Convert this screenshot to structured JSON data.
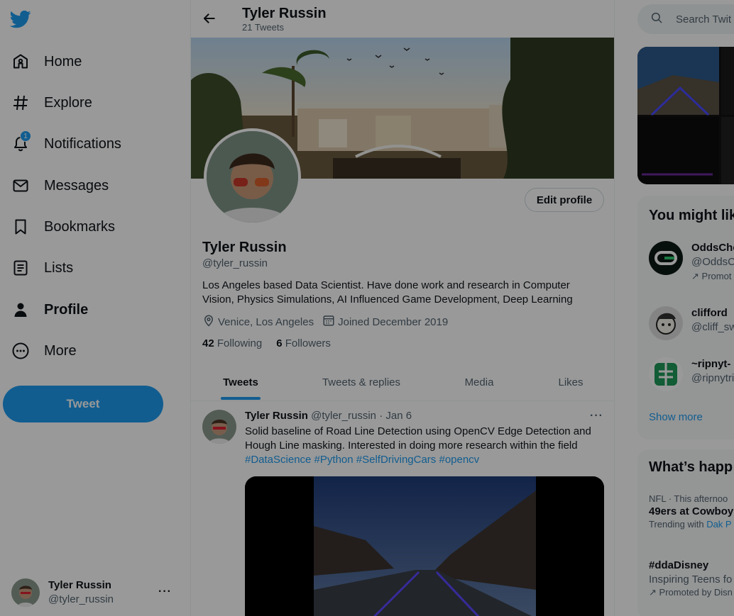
{
  "colors": {
    "accent": "#1d9bf0",
    "text": "#0f1419",
    "muted": "#536471"
  },
  "nav": {
    "logo_icon": "twitter-bird-icon",
    "items": [
      {
        "label": "Home",
        "icon": "home-icon"
      },
      {
        "label": "Explore",
        "icon": "hashtag-icon"
      },
      {
        "label": "Notifications",
        "icon": "bell-icon",
        "badge": "1"
      },
      {
        "label": "Messages",
        "icon": "envelope-icon"
      },
      {
        "label": "Bookmarks",
        "icon": "bookmark-icon"
      },
      {
        "label": "Lists",
        "icon": "list-icon"
      },
      {
        "label": "Profile",
        "icon": "person-icon"
      },
      {
        "label": "More",
        "icon": "more-circle-icon"
      }
    ],
    "tweet_label": "Tweet",
    "account": {
      "name": "Tyler Russin",
      "handle": "@tyler_russin",
      "menu": "···"
    }
  },
  "header": {
    "title": "Tyler Russin",
    "subtitle": "21 Tweets"
  },
  "profile": {
    "edit_label": "Edit profile",
    "name": "Tyler Russin",
    "handle": "@tyler_russin",
    "bio_line1": "Los Angeles based Data Scientist. Have done work and research in Computer",
    "bio_line2": "Vision, Physics Simulations, AI Influenced Game Development, Deep Learning",
    "location": "Venice, Los Angeles",
    "joined": "Joined December 2019",
    "following_count": "42",
    "following_label": "Following",
    "followers_count": "6",
    "followers_label": "Followers"
  },
  "tabs": [
    {
      "label": "Tweets",
      "active": true
    },
    {
      "label": "Tweets & replies"
    },
    {
      "label": "Media"
    },
    {
      "label": "Likes"
    }
  ],
  "tweet": {
    "name": "Tyler Russin",
    "handle": "@tyler_russin",
    "sep": "·",
    "date": "Jan 6",
    "menu": "···",
    "line1": "Solid baseline of Road Line Detection using OpenCV Edge Detection and",
    "line2": "Hough Line masking. Interested in doing more research within the field",
    "hashtags": "#DataScience #Python #SelfDrivingCars #opencv"
  },
  "right": {
    "search_placeholder": "Search Twit",
    "wtf_title": "You might lik",
    "wtf": [
      {
        "name": "OddsChe",
        "handle": "@OddsC",
        "promo": "Promot"
      },
      {
        "name": "clifford",
        "handle": "@cliff_sw"
      },
      {
        "name": "~ripnyt-",
        "handle": "@ripnytri"
      }
    ],
    "show_more": "Show more",
    "happening_title": "What’s happ",
    "trends": [
      {
        "meta": "NFL · This afternoo",
        "title": "49ers at Cowboy",
        "with_label": "Trending with",
        "with_link": "Dak P"
      },
      {
        "title": "#ddaDisney",
        "desc": "Inspiring Teens fo",
        "promo": "Promoted by Disn"
      }
    ]
  }
}
